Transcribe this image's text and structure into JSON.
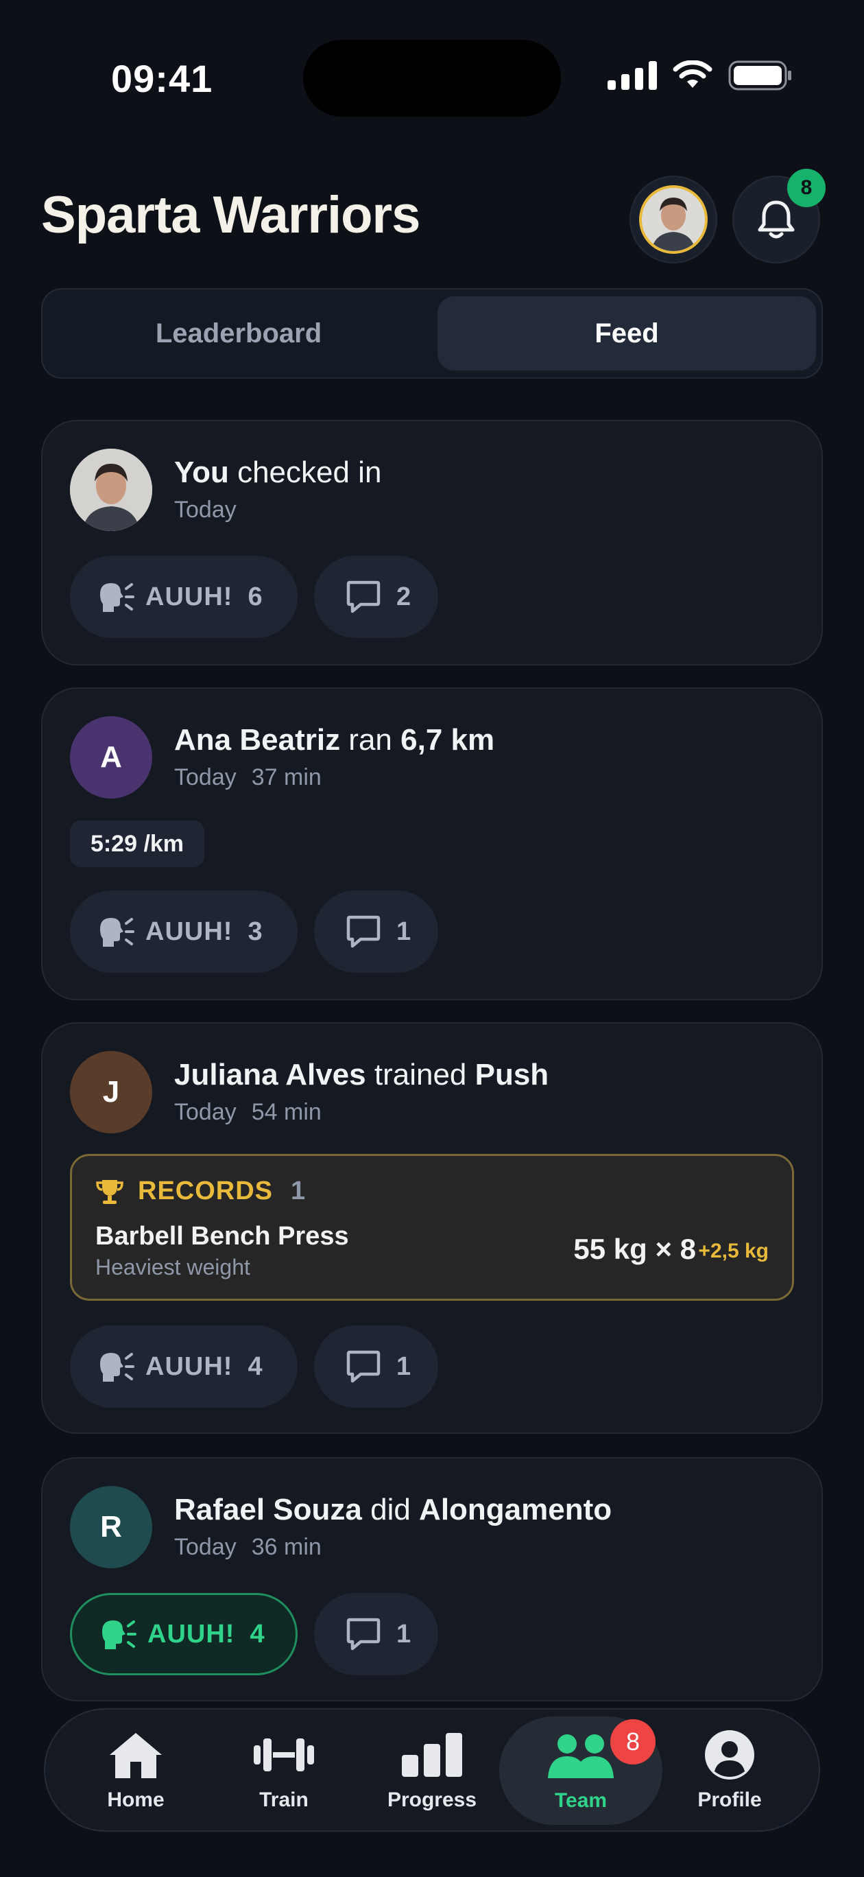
{
  "status_bar": {
    "time": "09:41"
  },
  "header": {
    "title": "Sparta Warriors",
    "notification_count": "8"
  },
  "segmented": {
    "left": "Leaderboard",
    "right": "Feed",
    "selected": "Feed"
  },
  "feed": [
    {
      "user": "You",
      "action": " checked in",
      "object": "",
      "date": "Today",
      "duration": "",
      "avatar_letter": "",
      "auuh_label": "AUUH!",
      "auuh_count": "6",
      "comments": "2"
    },
    {
      "user": "Ana Beatriz",
      "action": " ran ",
      "object": "6,7 km",
      "date": "Today",
      "duration": "37 min",
      "avatar_letter": "A",
      "pace": "5:29 /km",
      "auuh_label": "AUUH!",
      "auuh_count": "3",
      "comments": "1"
    },
    {
      "user": "Juliana Alves",
      "action": " trained ",
      "object": "Push",
      "date": "Today",
      "duration": "54 min",
      "avatar_letter": "J",
      "auuh_label": "AUUH!",
      "auuh_count": "4",
      "comments": "1",
      "records": {
        "label": "RECORDS",
        "count": "1",
        "exercise": "Barbell Bench Press",
        "type": "Heaviest weight",
        "value": "55 kg × 8",
        "delta": "+2,5 kg"
      }
    },
    {
      "user": "Rafael Souza",
      "action": " did ",
      "object": "Alongamento",
      "date": "Today",
      "duration": "36 min",
      "avatar_letter": "R",
      "auuh_label": "AUUH!",
      "auuh_count": "4",
      "comments": "1",
      "auuh_active": true
    }
  ],
  "tabbar": {
    "items": [
      {
        "label": "Home",
        "icon": "home-icon"
      },
      {
        "label": "Train",
        "icon": "dumbbell-icon"
      },
      {
        "label": "Progress",
        "icon": "bar-chart-icon"
      },
      {
        "label": "Team",
        "icon": "team-icon",
        "badge": "8",
        "active": true
      },
      {
        "label": "Profile",
        "icon": "profile-icon"
      }
    ]
  },
  "colors": {
    "accent_green": "#2fd38a",
    "gold": "#e8b93a",
    "badge_red": "#ef4444",
    "background": "#0d1117"
  }
}
